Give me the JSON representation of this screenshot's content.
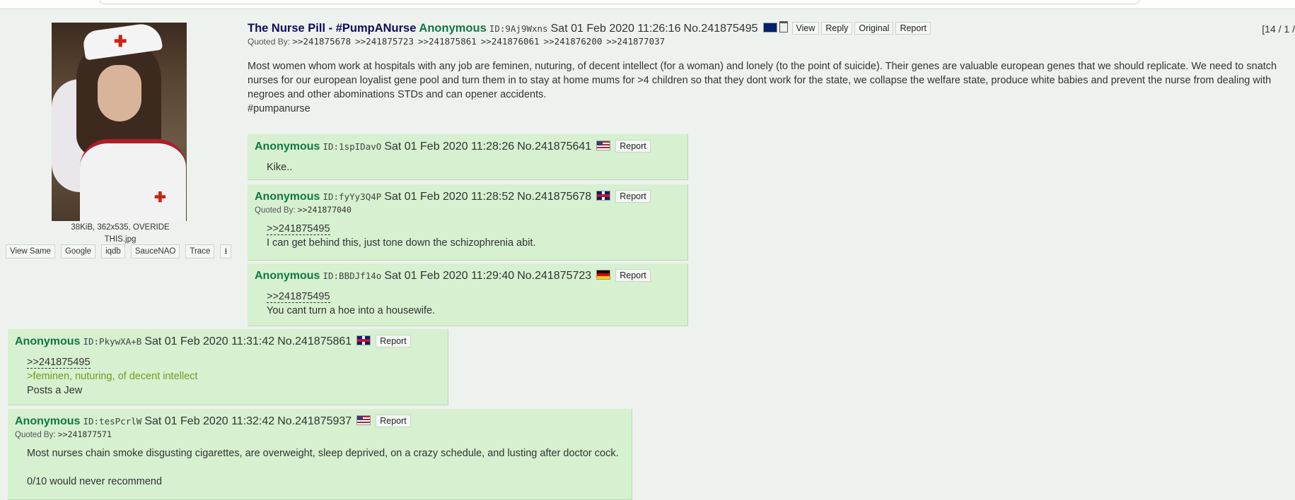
{
  "op": {
    "subject": "The Nurse Pill - #PumpANurse",
    "name": "Anonymous",
    "id": "ID:9Aj9Wxns",
    "date": "Sat 01 Feb 2020 11:26:16",
    "number": "No.241875495",
    "flag_icon": "flag-au",
    "buttons": {
      "view": "View",
      "reply": "Reply",
      "original": "Original",
      "report": "Report"
    },
    "counter": "[14 / 1 /",
    "quoted_by_label": "Quoted By:",
    "quoted_by": [
      ">>241875678",
      ">>241875723",
      ">>241875861",
      ">>241876061",
      ">>241876200",
      ">>241877037"
    ],
    "body_lines": [
      "Most women whom work at hospitals with any job are feminen, nuturing, of decent intellect (for a woman) and lonely (to the point of suicide). Their genes are valuable european genes that we should replicate. We need to snatch nurses for our european loyalist gene pool and turn them in to stay at home mums for >4 children so that they dont work for the state, we collapse the welfare state, produce white babies and prevent the nurse from dealing with negroes and other abominations STDs and can opener accidents.",
      "#pumpanurse"
    ],
    "file_info_1": "38KiB, 362x535, OVERIDE",
    "file_info_2": "THIS.jpg",
    "image_tools": [
      "View Same",
      "Google",
      "iqdb",
      "SauceNAO",
      "Trace"
    ]
  },
  "replies": [
    {
      "name": "Anonymous",
      "id": "ID:1spIDavO",
      "date": "Sat 01 Feb 2020 11:28:26",
      "number": "No.241875641",
      "flag_icon": "flag-us",
      "report": "Report",
      "quotelink": "",
      "lines": [
        "Kike.."
      ]
    },
    {
      "name": "Anonymous",
      "id": "ID:fyYy3Q4P",
      "date": "Sat 01 Feb 2020 11:28:52",
      "number": "No.241875678",
      "flag_icon": "flag-gb",
      "report": "Report",
      "quoted_by_label": "Quoted By:",
      "quoted_by": ">>241877040",
      "quotelink": ">>241875495",
      "lines": [
        "I can get behind this, just tone down the schizophrenia abit."
      ]
    },
    {
      "name": "Anonymous",
      "id": "ID:BBDJf14o",
      "date": "Sat 01 Feb 2020 11:29:40",
      "number": "No.241875723",
      "flag_icon": "flag-de",
      "report": "Report",
      "quotelink": ">>241875495",
      "lines": [
        "You cant turn a hoe into a housewife."
      ]
    },
    {
      "name": "Anonymous",
      "id": "ID:PkywXA+B",
      "date": "Sat 01 Feb 2020 11:31:42",
      "number": "No.241875861",
      "flag_icon": "flag-gb",
      "report": "Report",
      "quotelink": ">>241875495",
      "greentext": ">feminen, nuturing, of decent intellect",
      "lines": [
        "Posts a Jew"
      ]
    },
    {
      "name": "Anonymous",
      "id": "ID:tesPcrlW",
      "date": "Sat 01 Feb 2020 11:32:42",
      "number": "No.241875937",
      "flag_icon": "flag-us",
      "report": "Report",
      "quoted_by_label": "Quoted By:",
      "quoted_by": ">>241877571",
      "quotelink": "",
      "lines": [
        "Most nurses chain smoke disgusting cigarettes, are overweight, sleep deprived, on a crazy schedule, and lusting after doctor cock.",
        "0/10 would never recommend"
      ]
    }
  ],
  "colors": {
    "background": "#eef2ee",
    "reply_bg": "#d6f0d0",
    "name": "#117743",
    "subject": "#0f0c5d",
    "greentext": "#789922"
  }
}
